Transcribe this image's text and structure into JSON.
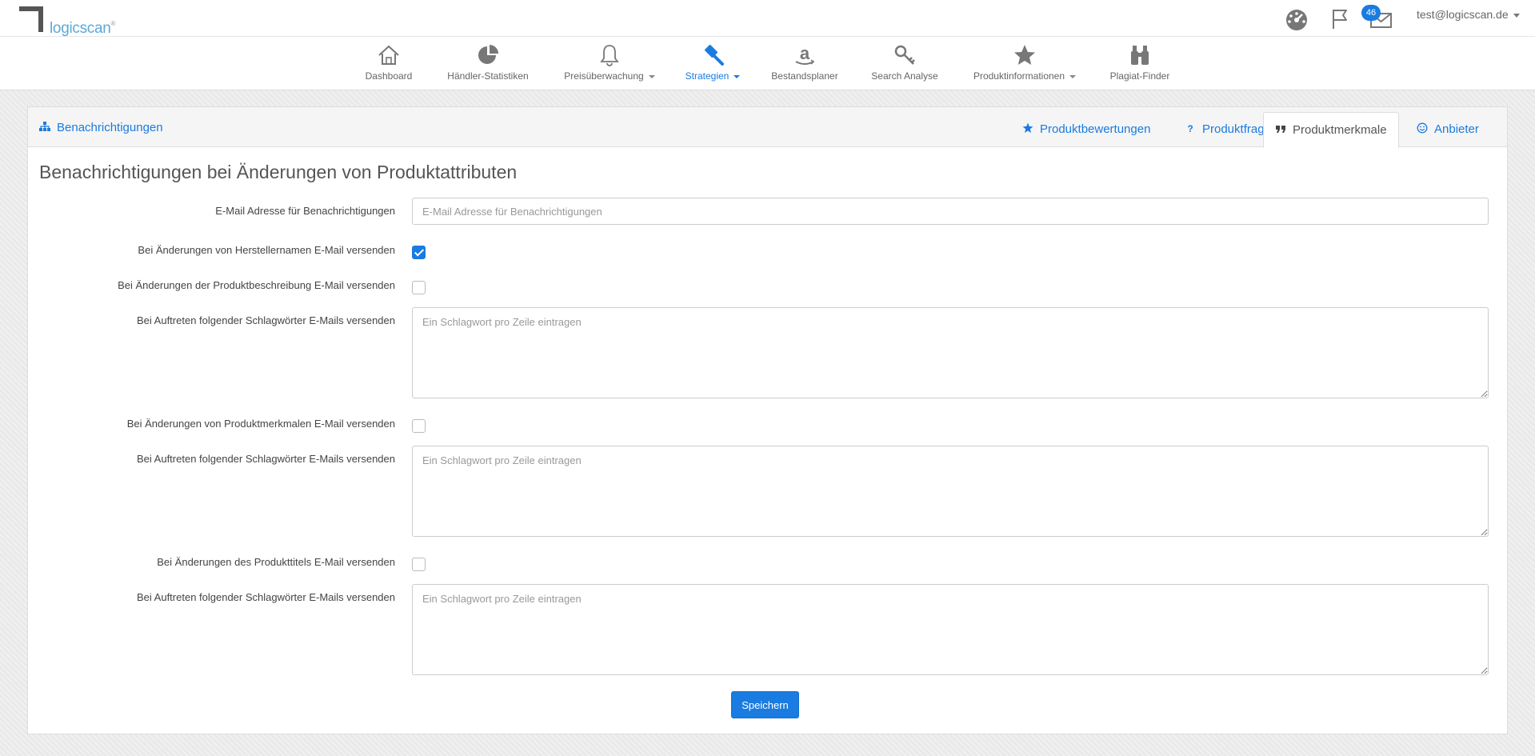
{
  "app": {
    "logo_text": "logicscan",
    "logo_reg": "®",
    "notification_count": "46",
    "user_email": "test@logicscan.de"
  },
  "nav": {
    "items": [
      {
        "label": "Dashboard",
        "icon": "home-icon"
      },
      {
        "label": "Händler-Statistiken",
        "icon": "pie-chart-icon"
      },
      {
        "label": "Preisüberwachung",
        "icon": "bell-icon",
        "has_caret": true
      },
      {
        "label": "Strategien",
        "icon": "gavel-icon",
        "has_caret": true,
        "active": true
      },
      {
        "label": "Bestandsplaner",
        "icon": "amazon-icon"
      },
      {
        "label": "Search Analyse",
        "icon": "key-icon"
      },
      {
        "label": "Produktinformationen",
        "icon": "star-icon",
        "has_caret": true
      },
      {
        "label": "Plagiat-Finder",
        "icon": "binoculars-icon"
      }
    ],
    "active_color": "#1a7be0"
  },
  "panel": {
    "header_title": "Benachrichtigungen",
    "tabs": [
      {
        "label": "Produktbewertungen",
        "icon": "star-icon"
      },
      {
        "label": "Produktfragen",
        "icon": "question-icon"
      },
      {
        "label": "Produktmerkmale",
        "icon": "quote-icon",
        "active": true
      },
      {
        "label": "Anbieter",
        "icon": "smiley-icon"
      }
    ]
  },
  "form": {
    "title": "Benachrichtigungen bei Änderungen von Produktattributen",
    "email_label": "E-Mail Adresse für Benachrichtigungen",
    "email_placeholder": "E-Mail Adresse für Benachrichtigungen",
    "email_value": "",
    "manufacturer_label": "Bei Änderungen von Herstellernamen E-Mail versenden",
    "manufacturer_checked": true,
    "description_label": "Bei Änderungen der Produktbeschreibung E-Mail versenden",
    "description_checked": false,
    "keywords1_label": "Bei Auftreten folgender Schlagwörter E-Mails versenden",
    "keywords1_placeholder": "Ein Schlagwort pro Zeile eintragen",
    "features_label": "Bei Änderungen von Produktmerkmalen E-Mail versenden",
    "features_checked": false,
    "keywords2_label": "Bei Auftreten folgender Schlagwörter E-Mails versenden",
    "keywords2_placeholder": "Ein Schlagwort pro Zeile eintragen",
    "title_change_label": "Bei Änderungen des Produkttitels E-Mail versenden",
    "title_change_checked": false,
    "keywords3_label": "Bei Auftreten folgender Schlagwörter E-Mails versenden",
    "keywords3_placeholder": "Ein Schlagwort pro Zeile eintragen",
    "save_label": "Speichern"
  }
}
